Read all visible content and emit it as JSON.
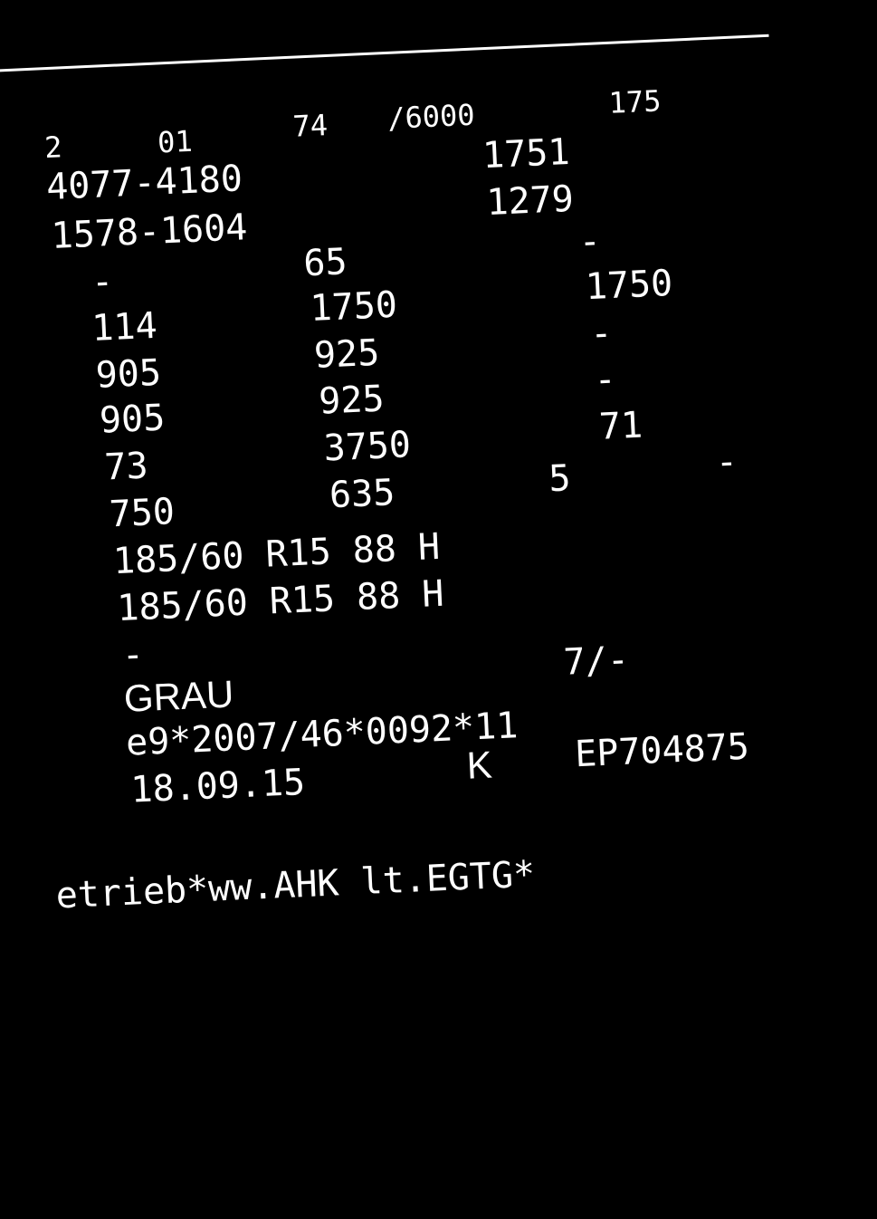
{
  "colors": {
    "background": "#000000",
    "text": "#ffffff"
  },
  "header_row": {
    "c1": "2",
    "c2": "01",
    "c3": "74",
    "c4": "/6000",
    "c5": "175"
  },
  "lines": {
    "l1_left": "4077-4180",
    "l1_right": "1751",
    "l2_left": "1578-1604",
    "l2_right": "1279",
    "l3_a": "-",
    "l3_b": "65",
    "l3_c": "-",
    "l4_a": "114",
    "l4_b": "1750",
    "l4_c": "1750",
    "l5_a": "905",
    "l5_b": "925",
    "l5_c": "-",
    "l6_a": "905",
    "l6_b": "925",
    "l6_c": "-",
    "l7_a": "73",
    "l7_b": "3750",
    "l7_c": "71",
    "l8_a": "750",
    "l8_b": "635",
    "l8_c": "5",
    "l8_d": "-",
    "tyre1": "185/60 R15 88 H",
    "tyre2": "185/60 R15 88 H",
    "dash": "-",
    "color_label": "GRAU",
    "color_code": "7/-",
    "approval": "e9*2007/46*0092*11",
    "date": "18.09.15",
    "k": "K",
    "ep": "EP704875",
    "footer": "etrieb*ww.AHK lt.EGTG*"
  }
}
